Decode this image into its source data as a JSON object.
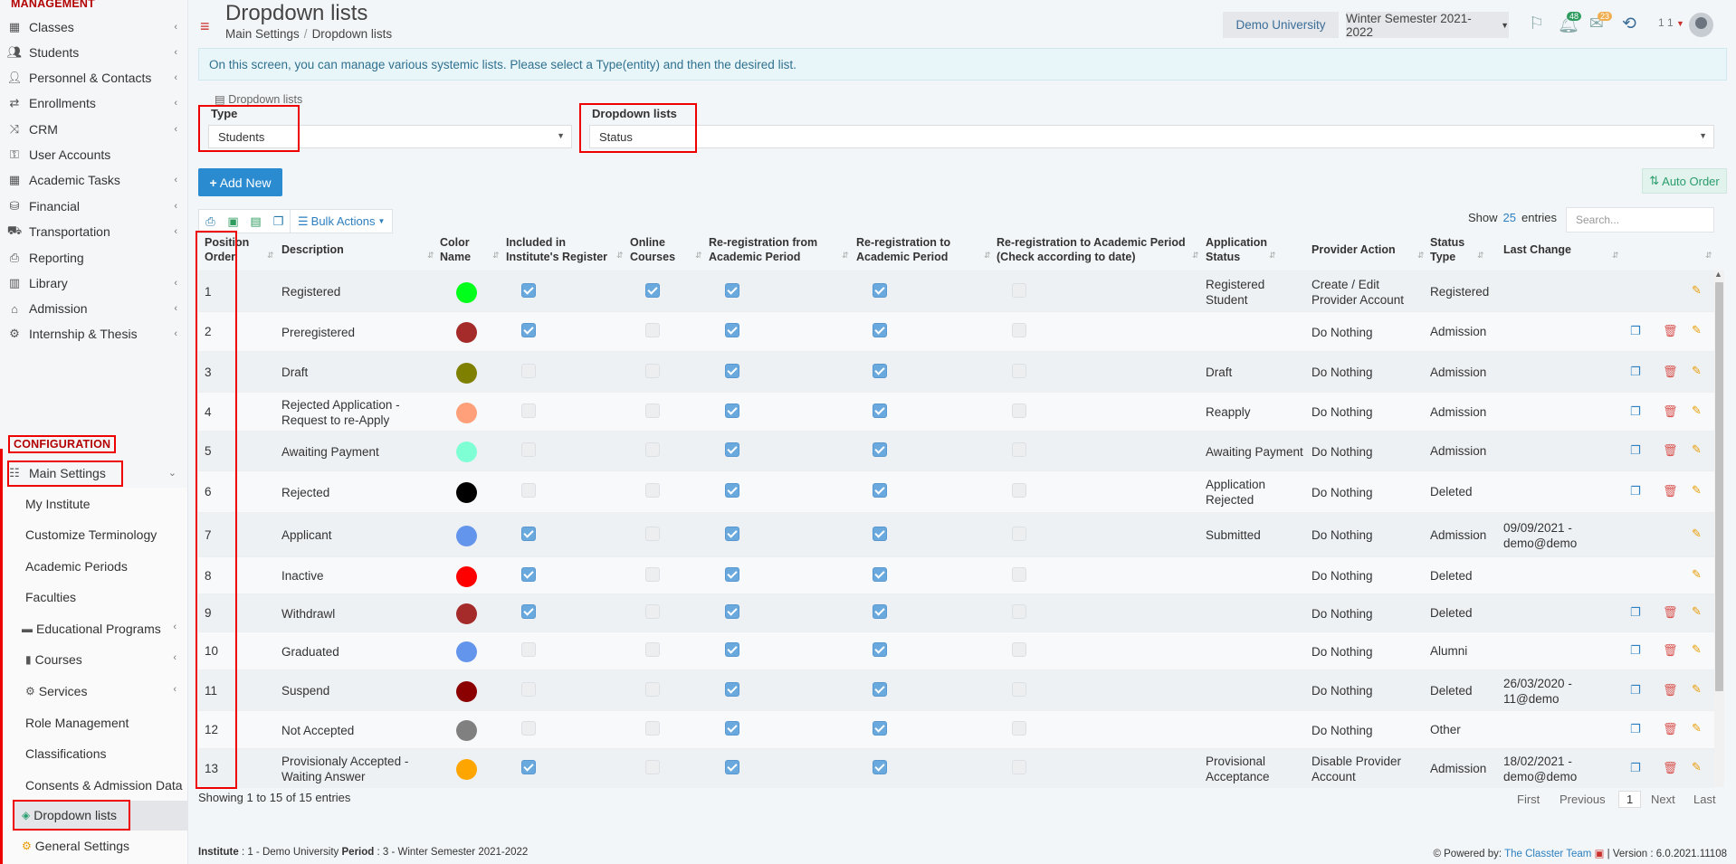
{
  "sidebar": {
    "management_title": "MANAGEMENT",
    "configuration_title": "CONFIGURATION",
    "items": [
      {
        "label": "Classes",
        "icon": "classes-icon",
        "chev": true
      },
      {
        "label": "Students",
        "icon": "students-icon",
        "chev": true
      },
      {
        "label": "Personnel & Contacts",
        "icon": "personnel-icon",
        "chev": true
      },
      {
        "label": "Enrollments",
        "icon": "enrollments-icon",
        "chev": true
      },
      {
        "label": "CRM",
        "icon": "crm-icon",
        "chev": true
      },
      {
        "label": "User Accounts",
        "icon": "key-icon",
        "chev": false
      },
      {
        "label": "Academic Tasks",
        "icon": "tasks-icon",
        "chev": true
      },
      {
        "label": "Financial",
        "icon": "financial-icon",
        "chev": true
      },
      {
        "label": "Transportation",
        "icon": "bus-icon",
        "chev": true
      },
      {
        "label": "Reporting",
        "icon": "print-icon",
        "chev": false
      },
      {
        "label": "Library",
        "icon": "library-icon",
        "chev": true
      },
      {
        "label": "Admission",
        "icon": "admission-icon",
        "chev": true
      },
      {
        "label": "Internship & Thesis",
        "icon": "internship-icon",
        "chev": true
      }
    ],
    "main_settings": "Main Settings",
    "sub_items": [
      {
        "label": "My Institute",
        "chev": false
      },
      {
        "label": "Customize Terminology",
        "chev": false
      },
      {
        "label": "Academic Periods",
        "chev": false
      },
      {
        "label": "Faculties",
        "chev": false
      },
      {
        "label": "Educational Programs",
        "chev": true
      },
      {
        "label": "Courses",
        "chev": true
      },
      {
        "label": "Services",
        "chev": true
      },
      {
        "label": "Role Management",
        "chev": false
      },
      {
        "label": "Classifications",
        "chev": false
      },
      {
        "label": "Consents & Admission Data",
        "chev": false
      },
      {
        "label": "Dropdown lists",
        "chev": false
      },
      {
        "label": "General Settings",
        "chev": false
      }
    ]
  },
  "header": {
    "title": "Dropdown lists",
    "breadcrumb": [
      "Main Settings",
      "Dropdown lists"
    ],
    "university": "Demo University",
    "semester": "Winter Semester 2021-2022",
    "notif_count": "48",
    "mail_count": "23",
    "user": "1 1"
  },
  "info_text": "On this screen, you can manage various systemic lists. Please select a Type(entity) and then the desired list.",
  "filters": {
    "panel_tag": "Dropdown lists",
    "type_label": "Type",
    "type_value": "Students",
    "list_label": "Dropdown lists",
    "list_value": "Status"
  },
  "toolbar": {
    "add_new": "Add New",
    "auto_order": "Auto Order",
    "bulk_actions": "Bulk Actions",
    "show": "Show",
    "entries_count": "25",
    "entries": "entries",
    "search_placeholder": "Search..."
  },
  "table": {
    "headers": {
      "position": [
        "Position",
        "Order"
      ],
      "description": "Description",
      "color": [
        "Color",
        "Name"
      ],
      "included": [
        "Included in",
        "Institute's Register"
      ],
      "online": [
        "Online",
        "Courses"
      ],
      "rereg_from": [
        "Re-registration from",
        "Academic Period"
      ],
      "rereg_to": [
        "Re-registration to",
        "Academic Period"
      ],
      "rereg_check": [
        "Re-registration to Academic Period",
        "(Check according to date)"
      ],
      "app_status": [
        "Application",
        "Status"
      ],
      "provider": "Provider Action",
      "status_type": [
        "Status",
        "Type"
      ],
      "last_change": "Last Change"
    },
    "rows": [
      {
        "pos": "1",
        "desc": [
          "Registered"
        ],
        "color": "#00ff1a",
        "inc": true,
        "onl": true,
        "from": true,
        "to": true,
        "chk": false,
        "app": [
          "Registered",
          "Student"
        ],
        "prov": [
          "Create / Edit",
          "Provider Account"
        ],
        "type": "Registered",
        "last": [],
        "copy": false,
        "del": false
      },
      {
        "pos": "2",
        "desc": [
          "Preregistered"
        ],
        "color": "#a52a2a",
        "inc": true,
        "onl": false,
        "from": true,
        "to": true,
        "chk": false,
        "app": [],
        "prov": [
          "Do Nothing"
        ],
        "type": "Admission",
        "last": [],
        "copy": true,
        "del": true
      },
      {
        "pos": "3",
        "desc": [
          "Draft"
        ],
        "color": "#808000",
        "inc": false,
        "onl": false,
        "from": true,
        "to": true,
        "chk": false,
        "app": [
          "Draft"
        ],
        "prov": [
          "Do Nothing"
        ],
        "type": "Admission",
        "last": [],
        "copy": true,
        "del": true
      },
      {
        "pos": "4",
        "desc": [
          "Rejected Application -",
          "Request to re-Apply"
        ],
        "color": "#ffa07a",
        "inc": false,
        "onl": false,
        "from": true,
        "to": true,
        "chk": false,
        "app": [
          "Reapply"
        ],
        "prov": [
          "Do Nothing"
        ],
        "type": "Admission",
        "last": [],
        "copy": true,
        "del": true
      },
      {
        "pos": "5",
        "desc": [
          "Awaiting Payment"
        ],
        "color": "#7fffd4",
        "inc": false,
        "onl": false,
        "from": true,
        "to": true,
        "chk": false,
        "app": [
          "Awaiting Payment"
        ],
        "prov": [
          "Do Nothing"
        ],
        "type": "Admission",
        "last": [],
        "copy": true,
        "del": true
      },
      {
        "pos": "6",
        "desc": [
          "Rejected"
        ],
        "color": "#000000",
        "inc": false,
        "onl": false,
        "from": true,
        "to": true,
        "chk": false,
        "app": [
          "Application",
          "Rejected"
        ],
        "prov": [
          "Do Nothing"
        ],
        "type": "Deleted",
        "last": [],
        "copy": true,
        "del": true
      },
      {
        "pos": "7",
        "desc": [
          "Applicant"
        ],
        "color": "#6495ed",
        "inc": true,
        "onl": false,
        "from": true,
        "to": true,
        "chk": false,
        "app": [
          "Submitted"
        ],
        "prov": [
          "Do Nothing"
        ],
        "type": "Admission",
        "last": [
          "09/09/2021 -",
          "demo@demo"
        ],
        "copy": false,
        "del": false
      },
      {
        "pos": "8",
        "desc": [
          "Inactive"
        ],
        "color": "#ff0000",
        "inc": true,
        "onl": false,
        "from": true,
        "to": true,
        "chk": false,
        "app": [],
        "prov": [
          "Do Nothing"
        ],
        "type": "Deleted",
        "last": [],
        "copy": false,
        "del": false
      },
      {
        "pos": "9",
        "desc": [
          "Withdrawl"
        ],
        "color": "#a52a2a",
        "inc": true,
        "onl": false,
        "from": true,
        "to": true,
        "chk": false,
        "app": [],
        "prov": [
          "Do Nothing"
        ],
        "type": "Deleted",
        "last": [],
        "copy": true,
        "del": true
      },
      {
        "pos": "10",
        "desc": [
          "Graduated"
        ],
        "color": "#6495ed",
        "inc": false,
        "onl": false,
        "from": true,
        "to": true,
        "chk": false,
        "app": [],
        "prov": [
          "Do Nothing"
        ],
        "type": "Alumni",
        "last": [],
        "copy": true,
        "del": true
      },
      {
        "pos": "11",
        "desc": [
          "Suspend"
        ],
        "color": "#8b0000",
        "inc": false,
        "onl": false,
        "from": true,
        "to": true,
        "chk": false,
        "app": [],
        "prov": [
          "Do Nothing"
        ],
        "type": "Deleted",
        "last": [
          "26/03/2020 -",
          "11@demo"
        ],
        "copy": true,
        "del": true
      },
      {
        "pos": "12",
        "desc": [
          "Not Accepted"
        ],
        "color": "#808080",
        "inc": false,
        "onl": false,
        "from": true,
        "to": true,
        "chk": false,
        "app": [],
        "prov": [
          "Do Nothing"
        ],
        "type": "Other",
        "last": [],
        "copy": true,
        "del": true
      },
      {
        "pos": "13",
        "desc": [
          "Provisionaly Accepted -",
          "Waiting Answer"
        ],
        "color": "#ffa500",
        "inc": true,
        "onl": false,
        "from": true,
        "to": true,
        "chk": false,
        "app": [
          "Provisional",
          "Acceptance"
        ],
        "prov": [
          "Disable Provider",
          "Account"
        ],
        "type": "Admission",
        "last": [
          "18/02/2021 -",
          "demo@demo"
        ],
        "copy": true,
        "del": true
      }
    ]
  },
  "footer": {
    "showing": "Showing 1 to 15 of 15 entries",
    "first": "First",
    "previous": "Previous",
    "page": "1",
    "next": "Next",
    "last": "Last",
    "institute_label": "Institute",
    "institute_value": ": 1 - Demo University",
    "period_label": "Period",
    "period_value": ": 3 - Winter Semester 2021-2022",
    "powered": "Powered by:",
    "team": "The Classter Team",
    "version": "| Version : 6.0.2021.11108"
  }
}
